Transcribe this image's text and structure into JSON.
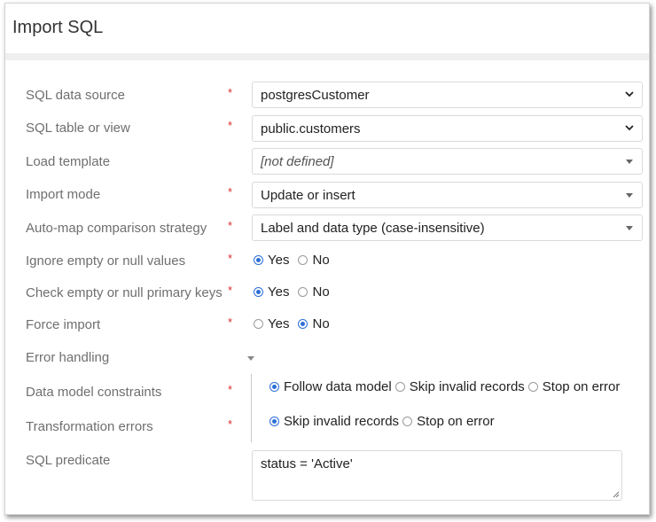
{
  "dialog": {
    "title": "Import SQL"
  },
  "fields": {
    "data_source": {
      "label": "SQL data source",
      "required": "*",
      "value": "postgresCustomer"
    },
    "table_view": {
      "label": "SQL table or view",
      "required": "*",
      "value": "public.customers"
    },
    "load_template": {
      "label": "Load template",
      "value": "[not defined]"
    },
    "import_mode": {
      "label": "Import mode",
      "required": "*",
      "value": "Update or insert"
    },
    "auto_map": {
      "label": "Auto-map comparison strategy",
      "required": "*",
      "value": "Label and data type (case-insensitive)"
    },
    "ignore_empty": {
      "label": "Ignore empty or null values",
      "required": "*",
      "options": [
        "Yes",
        "No"
      ],
      "selected": "Yes"
    },
    "check_pk": {
      "label": "Check empty or null primary keys",
      "required": "*",
      "options": [
        "Yes",
        "No"
      ],
      "selected": "Yes"
    },
    "force_import": {
      "label": "Force import",
      "required": "*",
      "options": [
        "Yes",
        "No"
      ],
      "selected": "No"
    },
    "error_handling": {
      "label": "Error handling"
    },
    "data_model": {
      "label": "Data model constraints",
      "required": "*",
      "options": [
        "Follow data model",
        "Skip invalid records",
        "Stop on error"
      ],
      "selected": "Follow data model"
    },
    "transformation": {
      "label": "Transformation errors",
      "required": "*",
      "options": [
        "Skip invalid records",
        "Stop on error"
      ],
      "selected": "Skip invalid records"
    },
    "sql_predicate": {
      "label": "SQL predicate",
      "value": "status = 'Active'"
    }
  }
}
